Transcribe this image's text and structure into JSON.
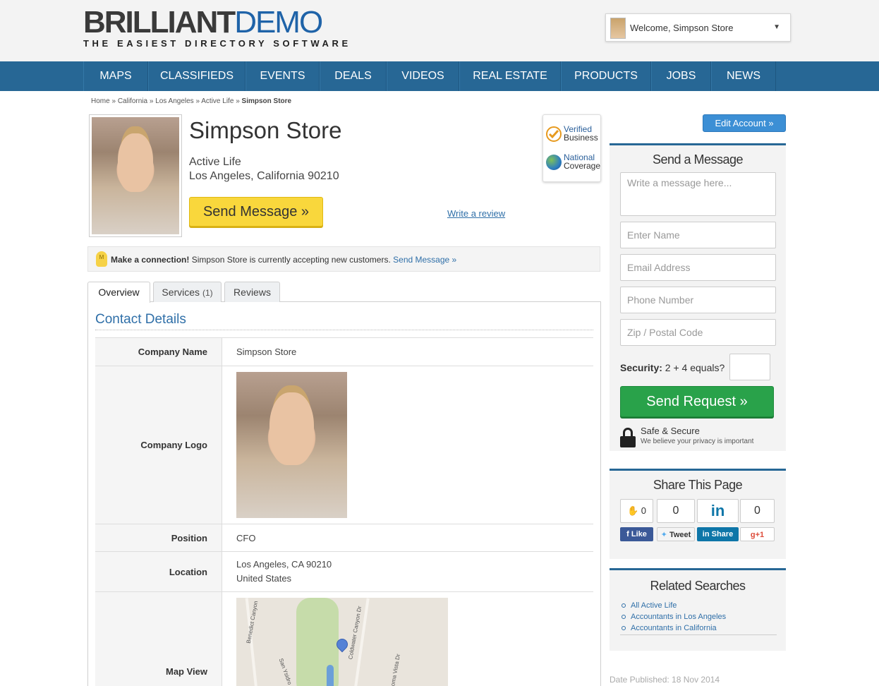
{
  "header": {
    "logo_part1": "BRILLIANT",
    "logo_part2": "DEMO",
    "tagline": "THE EASIEST DIRECTORY SOFTWARE",
    "welcome_text": "Welcome, Simpson Store",
    "caret": "▼"
  },
  "nav": {
    "items": [
      {
        "label": "MAPS"
      },
      {
        "label": "CLASSIFIEDS"
      },
      {
        "label": "EVENTS"
      },
      {
        "label": "DEALS"
      },
      {
        "label": "VIDEOS"
      },
      {
        "label": "REAL ESTATE"
      },
      {
        "label": "PRODUCTS"
      },
      {
        "label": "JOBS"
      },
      {
        "label": "NEWS"
      }
    ]
  },
  "breadcrumb": {
    "items": [
      "Home",
      "California",
      "Los Angeles",
      "Active Life"
    ],
    "separator": "»",
    "current": "Simpson Store"
  },
  "profile": {
    "name": "Simpson Store",
    "category": "Active Life",
    "address": "Los Angeles, California 90210",
    "send_message_label": "Send Message »",
    "write_review_label": "Write a review",
    "badge_verified_1": "Verified",
    "badge_verified_2": "Business",
    "badge_national_1": "National",
    "badge_national_2": "Coverage"
  },
  "connection": {
    "bulb_letter": "M",
    "bold": "Make a connection!",
    "text": " Simpson Store is currently accepting new customers. ",
    "link": "Send Message »"
  },
  "tabs": {
    "overview": "Overview",
    "services": "Services",
    "services_count": "(1)",
    "reviews": "Reviews"
  },
  "contact": {
    "title": "Contact Details",
    "company_name_label": "Company Name",
    "company_name_value": "Simpson Store",
    "company_logo_label": "Company Logo",
    "position_label": "Position",
    "position_value": "CFO",
    "location_label": "Location",
    "location_line1": "Los Angeles, CA 90210",
    "location_line2": "United States",
    "map_label": "Map View",
    "map_labels": {
      "canyon": "Benedict Canyon",
      "coldwater": "Coldwater Canyon Dr",
      "loma": "Loma Vista Dr",
      "ysidro": "San Ysidro"
    }
  },
  "sidebar": {
    "edit_account": "Edit Account »",
    "message_panel": {
      "title": "Send a Message",
      "message_placeholder": "Write a message here...",
      "name_placeholder": "Enter Name",
      "email_placeholder": "Email Address",
      "phone_placeholder": "Phone Number",
      "zip_placeholder": "Zip / Postal Code",
      "security_label": "Security:",
      "security_question": " 2 + 4 equals?",
      "send_request": "Send Request  »",
      "safe_title": "Safe & Secure",
      "safe_sub": "We believe your privacy is important"
    },
    "share_panel": {
      "title": "Share This Page",
      "like_count": "0",
      "tweet_count": "0",
      "linkedin_count": "in",
      "gplus_count": "0",
      "like_label": "Like",
      "tweet_label": "Tweet",
      "share_label": "Share",
      "gplus_label": "+1"
    },
    "related_panel": {
      "title": "Related Searches",
      "items": [
        "All Active Life",
        "Accountants in Los Angeles",
        "Accountants in California"
      ]
    },
    "date_published": "Date Published: 18 Nov 2014"
  },
  "colors": {
    "nav_blue": "#276795",
    "link_blue": "#2f6fa8",
    "send_yellow": "#f9d73c",
    "send_green": "#29a24a",
    "edit_blue": "#3c8fd5"
  }
}
